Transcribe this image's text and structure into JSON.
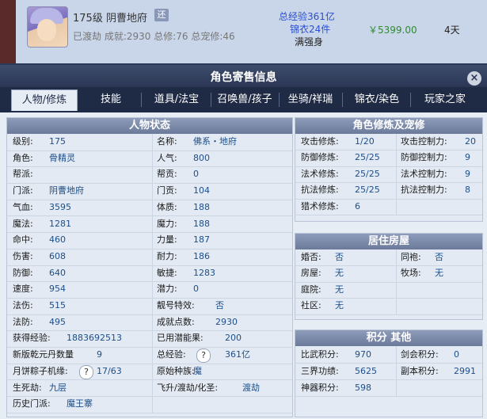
{
  "listing": {
    "level_server": "175级  阴曹地府",
    "tag": "还",
    "meta": "已渡劫 成就:2930 总修:76 总宠修:46",
    "exp_line1": "总经验361亿",
    "exp_line2": "锦衣24件",
    "exp_line3": "满强身",
    "price": "￥5399.00",
    "days": "4天"
  },
  "dialog": {
    "title": "角色寄售信息",
    "close": "×",
    "tabs": [
      "人物/修炼",
      "技能",
      "道具/法宝",
      "召唤兽/孩子",
      "坐骑/祥瑞",
      "锦衣/染色",
      "玩家之家"
    ]
  },
  "status": {
    "title": "人物状态",
    "rows": [
      {
        "l1": "级别:",
        "v1": "175",
        "l2": "名称:",
        "v2": "佛系・地府"
      },
      {
        "l1": "角色:",
        "v1": "骨精灵",
        "l2": "人气:",
        "v2": "800"
      },
      {
        "l1": "帮派:",
        "v1": "",
        "l2": "帮贡:",
        "v2": "0"
      },
      {
        "l1": "门派:",
        "v1": "阴曹地府",
        "l2": "门贡:",
        "v2": "104"
      },
      {
        "l1": "气血:",
        "v1": "3595",
        "l2": "体质:",
        "v2": "188"
      },
      {
        "l1": "魔法:",
        "v1": "1281",
        "l2": "魔力:",
        "v2": "188"
      },
      {
        "l1": "命中:",
        "v1": "460",
        "l2": "力量:",
        "v2": "187"
      },
      {
        "l1": "伤害:",
        "v1": "608",
        "l2": "耐力:",
        "v2": "186"
      },
      {
        "l1": "防御:",
        "v1": "640",
        "l2": "敏捷:",
        "v2": "1283"
      },
      {
        "l1": "速度:",
        "v1": "954",
        "l2": "潜力:",
        "v2": "0"
      },
      {
        "l1": "法伤:",
        "v1": "515",
        "l2": "靓号特效:",
        "v2": "否"
      },
      {
        "l1": "法防:",
        "v1": "495",
        "l2": "成就点数:",
        "v2": "2930"
      },
      {
        "l1": "获得经验:",
        "v1": "1883692513",
        "l2": "已用潜能果:",
        "v2": "200"
      },
      {
        "l1": "新版乾元丹数量",
        "v1": "9",
        "l2": "总经验:",
        "v2": "361亿"
      },
      {
        "l1": "月饼粽子机缘:",
        "v1": "17/63",
        "l2": "原始种族:",
        "v2": "魔"
      },
      {
        "l1": "生死劫:",
        "v1": "九层",
        "l2": "飞升/渡劫/化圣:",
        "v2": "渡劫"
      },
      {
        "l1": "历史门派:",
        "v1": "魔王寨",
        "l2": "",
        "v2": ""
      }
    ]
  },
  "cultivation": {
    "title": "角色修炼及宠修",
    "rows": [
      {
        "l1": "攻击修炼:",
        "v1": "1/20",
        "l2": "攻击控制力:",
        "v2": "20"
      },
      {
        "l1": "防御修炼:",
        "v1": "25/25",
        "l2": "防御控制力:",
        "v2": "9"
      },
      {
        "l1": "法术修炼:",
        "v1": "25/25",
        "l2": "法术控制力:",
        "v2": "9"
      },
      {
        "l1": "抗法修炼:",
        "v1": "25/25",
        "l2": "抗法控制力:",
        "v2": "8"
      },
      {
        "l1": "猎术修炼:",
        "v1": "6",
        "l2": "",
        "v2": ""
      }
    ]
  },
  "housing": {
    "title": "居住房屋",
    "rows": [
      {
        "l1": "婚否:",
        "v1": "否",
        "l2": "同袍:",
        "v2": "否"
      },
      {
        "l1": "房屋:",
        "v1": "无",
        "l2": "牧场:",
        "v2": "无"
      },
      {
        "l1": "庭院:",
        "v1": "无",
        "l2": "",
        "v2": ""
      },
      {
        "l1": "社区:",
        "v1": "无",
        "l2": "",
        "v2": ""
      }
    ]
  },
  "points": {
    "title": "积分 其他",
    "rows": [
      {
        "l1": "比武积分:",
        "v1": "970",
        "l2": "剑会积分:",
        "v2": "0"
      },
      {
        "l1": "三界功绩:",
        "v1": "5625",
        "l2": "副本积分:",
        "v2": "2991"
      },
      {
        "l1": "神器积分:",
        "v1": "598",
        "l2": "",
        "v2": ""
      }
    ]
  }
}
